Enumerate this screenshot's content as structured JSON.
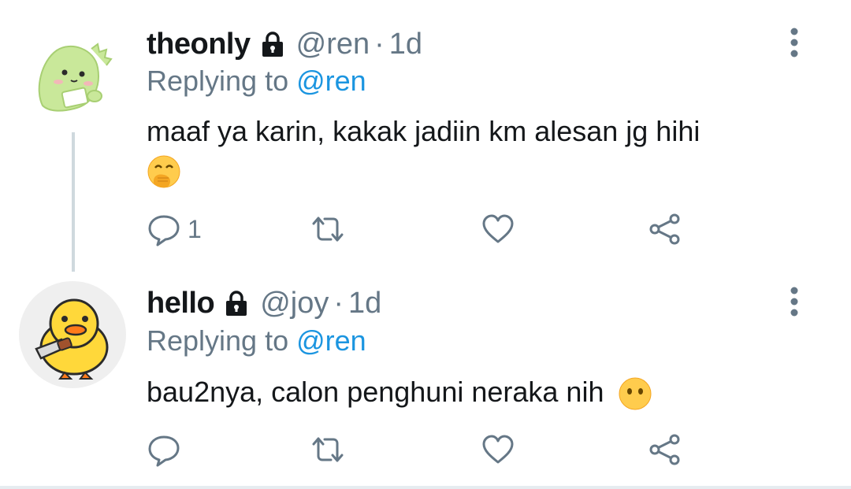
{
  "tweets": [
    {
      "username": "theonly",
      "handle": "@ren",
      "separator": "·",
      "time": "1d",
      "replying_prefix": "Replying to",
      "replying_to": "@ren",
      "text": "maaf ya karin, kakak jadiin km alesan jg hihi",
      "emoji": "face-with-hand-over-mouth",
      "reply_count": "1",
      "avatar": "green-dinosaur-avatar"
    },
    {
      "username": "hello",
      "handle": "@joy",
      "separator": "·",
      "time": "1d",
      "replying_prefix": "Replying to",
      "replying_to": "@ren",
      "text": "bau2nya, calon penghuni neraka nih",
      "emoji": "face-without-mouth",
      "reply_count": "",
      "avatar": "yellow-duck-with-knife-avatar"
    }
  ],
  "colors": {
    "text": "#14171a",
    "secondary": "#657786",
    "link": "#1b95e0",
    "icon": "#657786",
    "thread_line": "#cfd9de"
  },
  "icons": [
    "lock-icon",
    "more-options-icon",
    "reply-icon",
    "retweet-icon",
    "like-icon",
    "share-icon"
  ]
}
